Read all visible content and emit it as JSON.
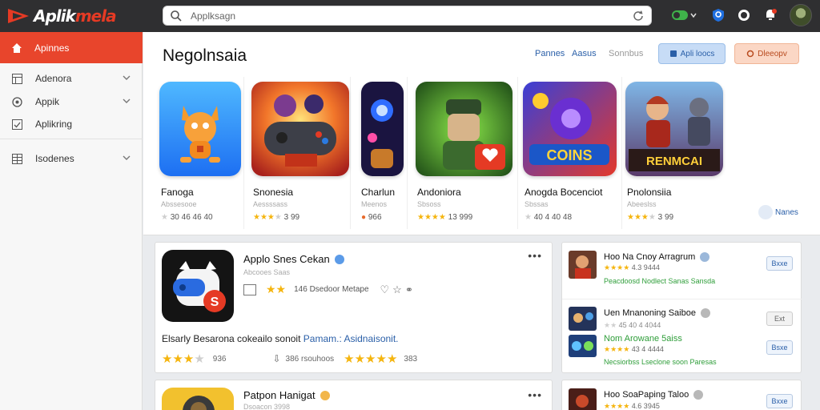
{
  "colors": {
    "accent": "#e8452c",
    "link": "#2a5fa8",
    "star": "#f5b50f",
    "topbar": "#2f2f31"
  },
  "app": {
    "logo_text": "Aplik",
    "logo_text_accent": "mela"
  },
  "search": {
    "value": "Applksagn"
  },
  "toolbar": {
    "ext_label": "on",
    "icons": [
      "reload-icon",
      "puzzle-icon",
      "shield-icon",
      "circle-play-icon",
      "bell-icon"
    ]
  },
  "sidebar": {
    "items": [
      {
        "label": "Apinnes",
        "icon": "home-icon",
        "active": true
      },
      {
        "label": "Adenora",
        "icon": "grid-icon"
      },
      {
        "label": "Appik",
        "icon": "compass-icon"
      },
      {
        "label": "Aplikring",
        "icon": "check-square-icon"
      },
      {
        "label": "Isodenes",
        "icon": "table-icon"
      }
    ]
  },
  "featured": {
    "title": "Negolnsaia",
    "tabs": [
      "Pannes",
      "Aasus",
      "Sonnbus"
    ],
    "button_primary": "Apli loocs",
    "button_secondary": "Dleeopv",
    "more_label": "Nanes",
    "cards": [
      {
        "name": "Fanoga",
        "sub": "Abssesooe",
        "stars": 0,
        "rating": "30 46 46 40"
      },
      {
        "name": "Snonesia",
        "sub": "Aessssass",
        "stars": 3,
        "rating": "3 99"
      },
      {
        "name": "Charlun",
        "sub": "Meenos",
        "stars": 0,
        "rating": "966"
      },
      {
        "name": "Andoniora",
        "sub": "Sbsoss",
        "stars": 4,
        "rating": "13 999"
      },
      {
        "name": "Anogda Bocenciot",
        "sub": "Sbssas",
        "stars": 0,
        "rating": "40 4 40 48"
      },
      {
        "name": "Pnolonsiia",
        "sub": "Abeeslss",
        "stars": 3,
        "rating": "3 99"
      }
    ]
  },
  "big_cards": [
    {
      "title": "Applo Snes Cekan",
      "sub": "Abcooes Saas",
      "meta": "146 Dsedoor Metape",
      "description": "Elsarly Besarona cokeailo sonoit",
      "links": "Pamam.: Asidnaisonit.",
      "footer_left": "936",
      "footer_mid": "386 rsouhoos",
      "footer_right": "383"
    },
    {
      "title": "Patpon Hanigat",
      "sub": "Dsoacon 3998"
    }
  ],
  "side_list": [
    {
      "name": "Hoo Na Cnoy Arragrum",
      "stars": "4.3 9444",
      "sub": "Peacdoosd Nodlect Sanas Sansda",
      "button": "Bxxe"
    },
    {
      "name": "Uen Mnanoning Saiboe",
      "stars": "45 40 4 4044",
      "sub": "",
      "button": "Ext"
    },
    {
      "name": "Nom Arowane 5aiss",
      "stars": "43 4 4444",
      "sub": "Necsiorbss Lseclone soon Paresas",
      "button": "Bsxe"
    },
    {
      "name": "Hoo SoaPaping Taloo",
      "stars": "4.6 3945",
      "sub": "",
      "button": "Bxxe"
    }
  ]
}
